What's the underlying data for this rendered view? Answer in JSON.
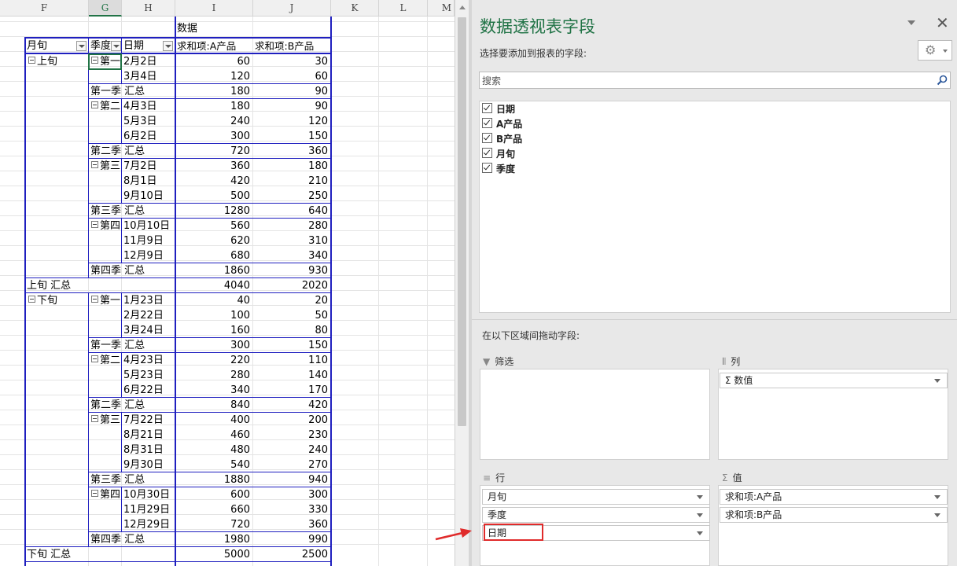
{
  "columns": [
    "F",
    "G",
    "H",
    "I",
    "J",
    "K",
    "L",
    "M"
  ],
  "pivot": {
    "values_caption": "数据",
    "headers": {
      "col_f": "月旬",
      "col_g": "季度",
      "col_h": "日期",
      "col_i": "求和项:A产品",
      "col_j": "求和项:B产品"
    },
    "group1": {
      "label": "上旬",
      "q1": {
        "label": "第一",
        "subtotal": "第一季 汇总",
        "subtotal_a": "180",
        "subtotal_b": "90",
        "rows": [
          [
            "2月2日",
            "60",
            "30"
          ],
          [
            "3月4日",
            "120",
            "60"
          ]
        ]
      },
      "q2": {
        "label": "第二",
        "subtotal": "第二季 汇总",
        "subtotal_a": "720",
        "subtotal_b": "360",
        "rows": [
          [
            "4月3日",
            "180",
            "90"
          ],
          [
            "5月3日",
            "240",
            "120"
          ],
          [
            "6月2日",
            "300",
            "150"
          ]
        ]
      },
      "q3": {
        "label": "第三",
        "subtotal": "第三季 汇总",
        "subtotal_a": "1280",
        "subtotal_b": "640",
        "rows": [
          [
            "7月2日",
            "360",
            "180"
          ],
          [
            "8月1日",
            "420",
            "210"
          ],
          [
            "9月10日",
            "500",
            "250"
          ]
        ]
      },
      "q4": {
        "label": "第四",
        "subtotal": "第四季 汇总",
        "subtotal_a": "1860",
        "subtotal_b": "930",
        "rows": [
          [
            "10月10日",
            "560",
            "280"
          ],
          [
            "11月9日",
            "620",
            "310"
          ],
          [
            "12月9日",
            "680",
            "340"
          ]
        ]
      },
      "total": "上旬 汇总",
      "total_a": "4040",
      "total_b": "2020"
    },
    "group2": {
      "label": "下旬",
      "q1": {
        "label": "第一",
        "subtotal": "第一季 汇总",
        "subtotal_a": "300",
        "subtotal_b": "150",
        "rows": [
          [
            "1月23日",
            "40",
            "20"
          ],
          [
            "2月22日",
            "100",
            "50"
          ],
          [
            "3月24日",
            "160",
            "80"
          ]
        ]
      },
      "q2": {
        "label": "第二",
        "subtotal": "第二季 汇总",
        "subtotal_a": "840",
        "subtotal_b": "420",
        "rows": [
          [
            "4月23日",
            "220",
            "110"
          ],
          [
            "5月23日",
            "280",
            "140"
          ],
          [
            "6月22日",
            "340",
            "170"
          ]
        ]
      },
      "q3": {
        "label": "第三",
        "subtotal": "第三季 汇总",
        "subtotal_a": "1880",
        "subtotal_b": "940",
        "rows": [
          [
            "7月22日",
            "400",
            "200"
          ],
          [
            "8月21日",
            "460",
            "230"
          ],
          [
            "8月31日",
            "480",
            "240"
          ],
          [
            "9月30日",
            "540",
            "270"
          ]
        ]
      },
      "q4": {
        "label": "第四",
        "subtotal": "第四季 汇总",
        "subtotal_a": "1980",
        "subtotal_b": "990",
        "rows": [
          [
            "10月30日",
            "600",
            "300"
          ],
          [
            "11月29日",
            "660",
            "330"
          ],
          [
            "12月29日",
            "720",
            "360"
          ]
        ]
      },
      "total": "下旬 汇总",
      "total_a": "5000",
      "total_b": "2500"
    }
  },
  "panel": {
    "title": "数据透视表字段",
    "subtitle": "选择要添加到报表的字段:",
    "search_placeholder": "搜索",
    "fields": [
      "日期",
      "A产品",
      "B产品",
      "月旬",
      "季度"
    ],
    "drag_label": "在以下区域间拖动字段:",
    "filter_label": "筛选",
    "columns_label": "列",
    "rows_label": "行",
    "values_label": "值",
    "columns_items": [
      "Σ  数值"
    ],
    "rows_items": [
      "月旬",
      "季度",
      "日期"
    ],
    "values_items": [
      "求和项:A产品",
      "求和项:B产品"
    ]
  },
  "colors": {
    "accent": "#217346",
    "pivot_border": "#1f1fbf",
    "highlight": "#e02b2b"
  }
}
